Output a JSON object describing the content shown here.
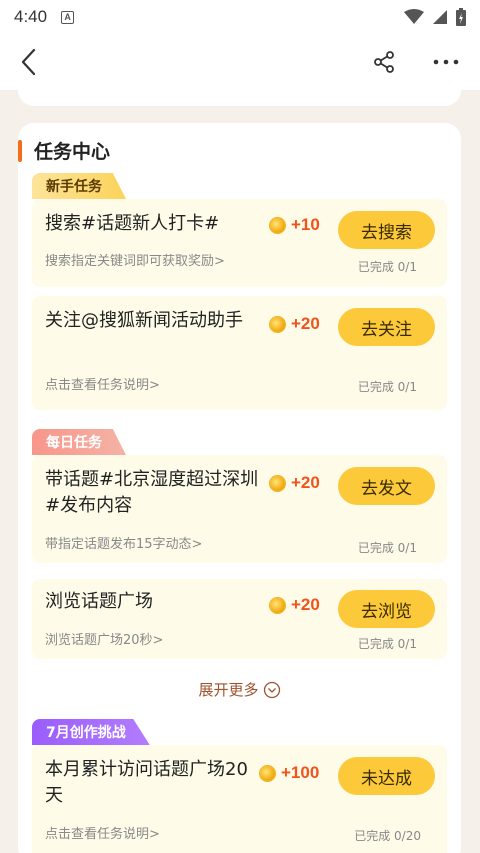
{
  "status_bar": {
    "time": "4:40",
    "notif_icon": "a-icon"
  },
  "nav": {
    "back_icon": "chevron-left-icon",
    "share_icon": "share-icon",
    "more_icon": "more-icon"
  },
  "task_center": {
    "title": "任务中心",
    "sections": [
      {
        "tag": "新手任务",
        "tasks": [
          {
            "title": "搜索#话题新人打卡#",
            "desc": "搜索指定关键词即可获取奖励>",
            "points": "+10",
            "button": "去搜索",
            "progress": "已完成 0/1"
          },
          {
            "title": "关注@搜狐新闻活动助手",
            "desc": "点击查看任务说明>",
            "points": "+20",
            "button": "去关注",
            "progress": "已完成 0/1"
          }
        ]
      },
      {
        "tag": "每日任务",
        "tasks": [
          {
            "title": "带话题#北京湿度超过深圳#发布内容",
            "desc": "带指定话题发布15字动态>",
            "points": "+20",
            "button": "去发文",
            "progress": "已完成 0/1"
          },
          {
            "title": "浏览话题广场",
            "desc": "浏览话题广场20秒>",
            "points": "+20",
            "button": "去浏览",
            "progress": "已完成 0/1"
          }
        ]
      },
      {
        "tag": "7月创作挑战",
        "tasks": [
          {
            "title": "本月累计访问话题广场20天",
            "desc": "点击查看任务说明>",
            "points": "+100",
            "button": "未达成",
            "progress": "已完成 0/20"
          }
        ]
      }
    ],
    "expand_label": "展开更多"
  },
  "colors": {
    "accent_orange": "#f26d1c",
    "button_yellow": "#fcc93a",
    "points_red": "#f0531c",
    "task_bg": "#fffbe9"
  }
}
